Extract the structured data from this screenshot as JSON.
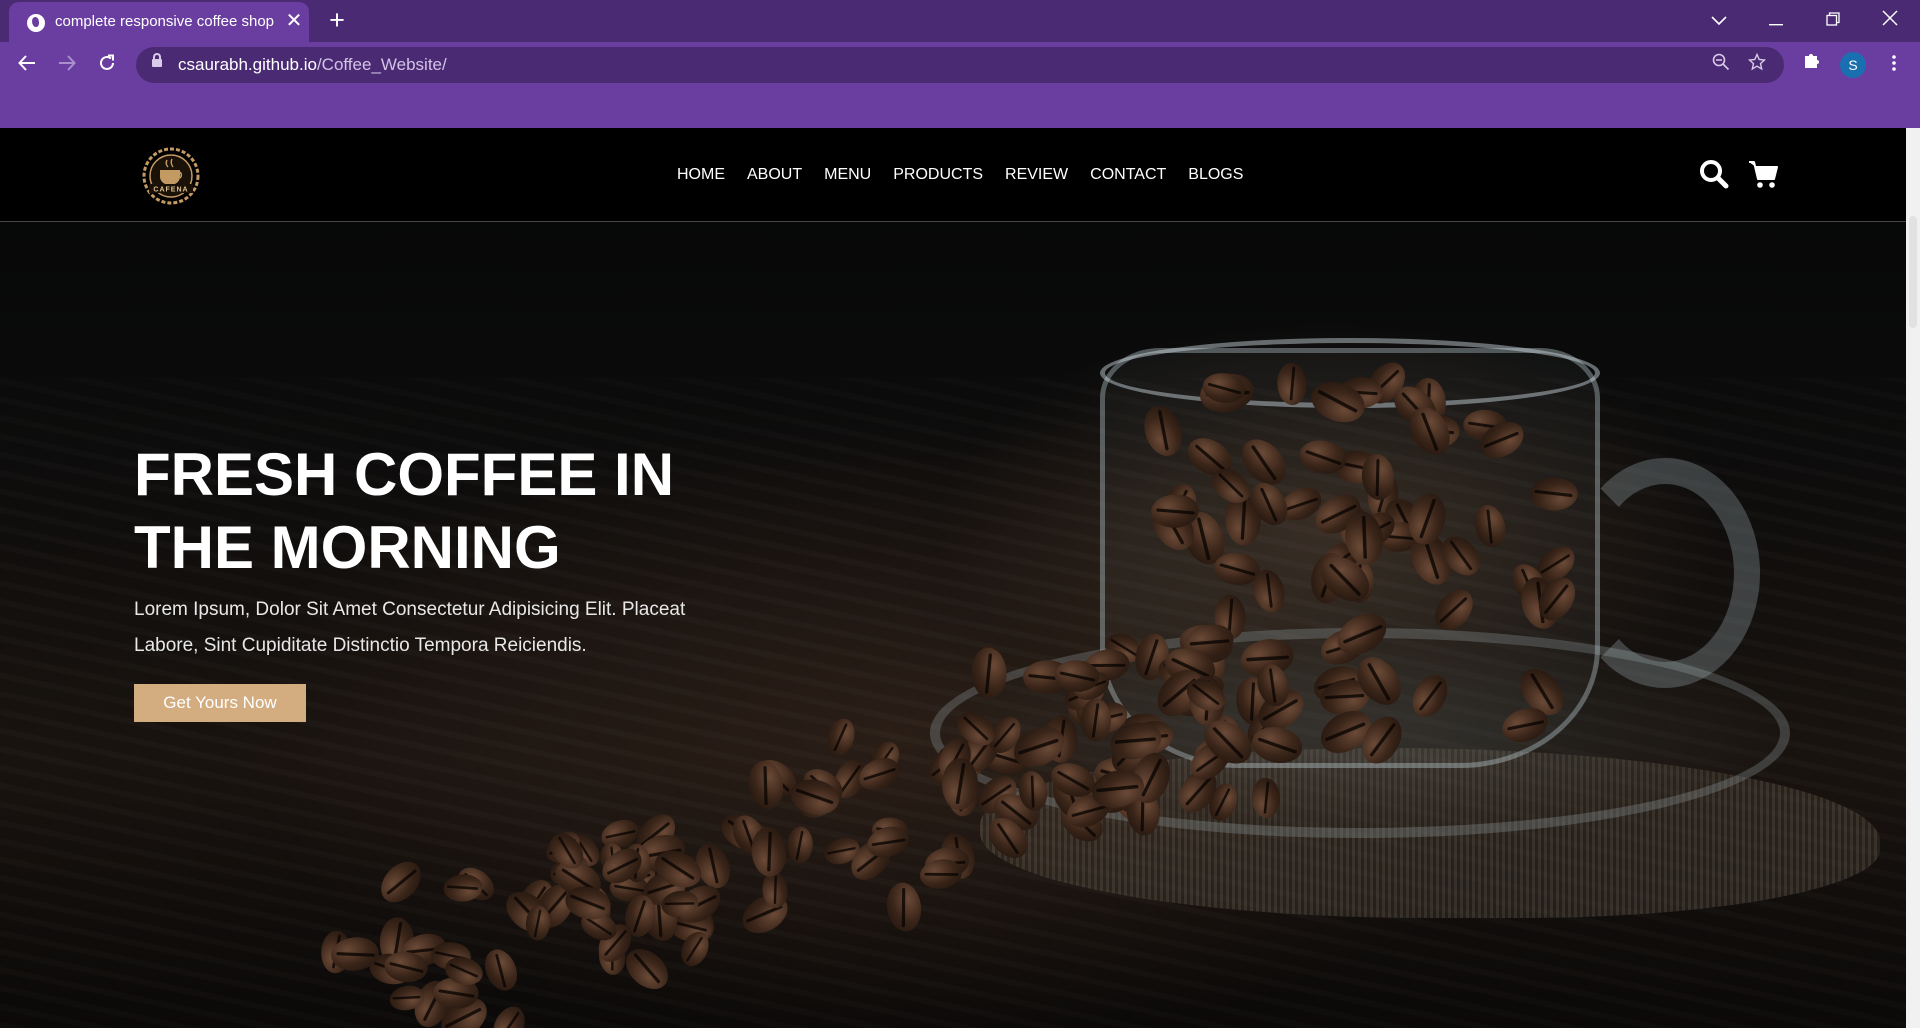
{
  "browser": {
    "tab_title": "complete responsive coffee shop website design",
    "url_host": "csaurabh.github.io",
    "url_path": "/Coffee_Website/",
    "profile_initial": "S",
    "theme_color": "#6a3ea1"
  },
  "site": {
    "nav": [
      "HOME",
      "ABOUT",
      "MENU",
      "PRODUCTS",
      "REVIEW",
      "CONTACT",
      "BLOGS"
    ],
    "logo_text": "CAFENA",
    "hero": {
      "title_line1": "FRESH COFFEE IN",
      "title_line2": "THE MORNING",
      "subtitle_line1": "Lorem Ipsum, Dolor Sit Amet Consectetur Adipisicing Elit. Placeat",
      "subtitle_line2": "Labore, Sint Cupiditate Distinctio Tempora Reiciendis.",
      "cta_label": "Get Yours Now"
    },
    "accent_color": "#d3ad7f",
    "icons": [
      "search-icon",
      "cart-icon"
    ]
  }
}
